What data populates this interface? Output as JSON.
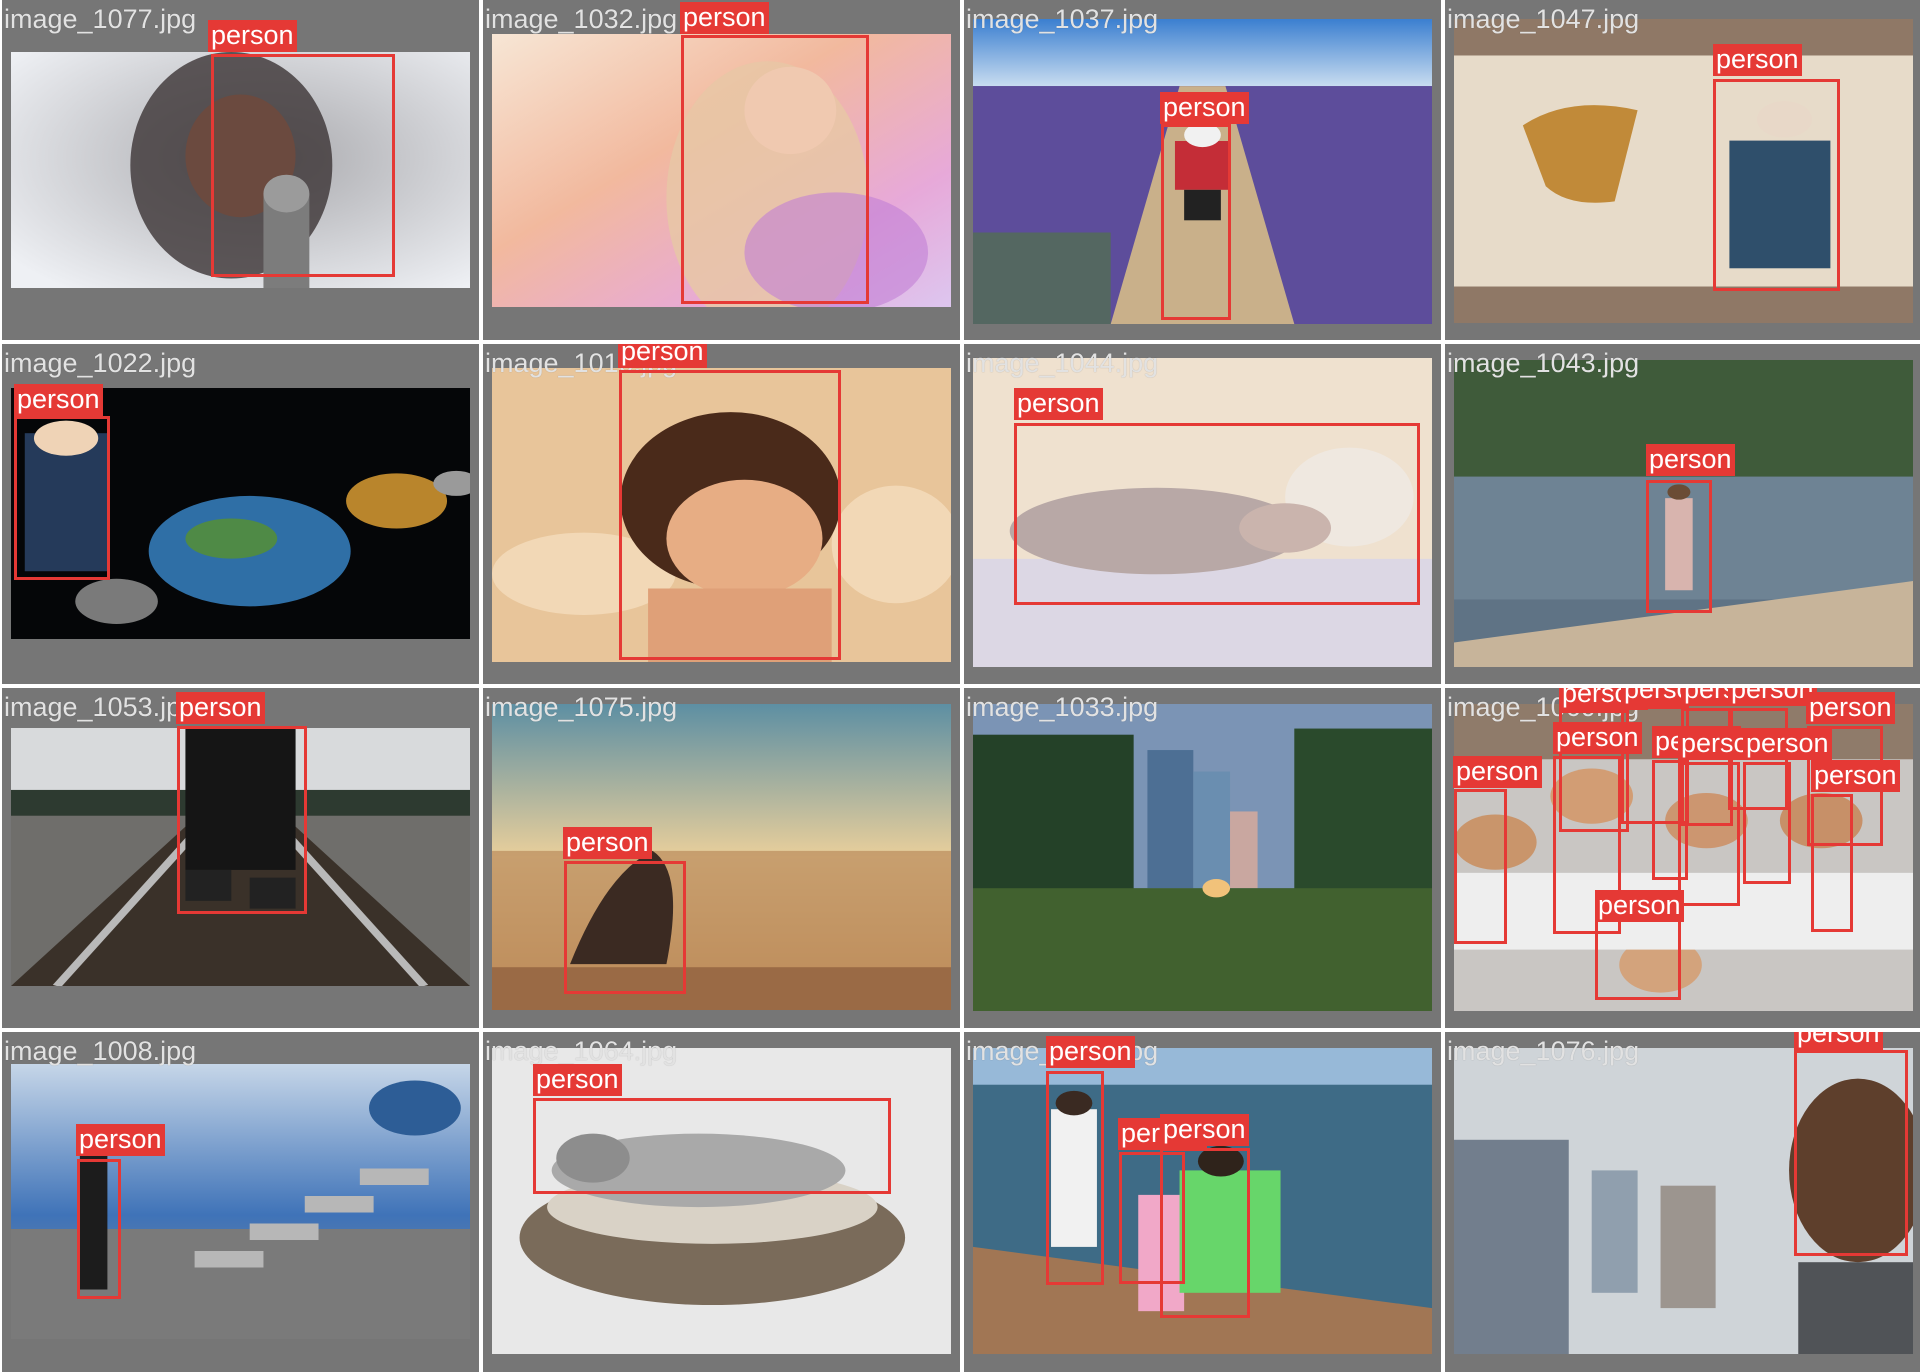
{
  "colors": {
    "tile_bg": "#767676",
    "box": "#e53935",
    "label_text": "#ffffff",
    "filename_text": "#e2e2e2"
  },
  "tiles": [
    {
      "filename": "image_1077.jpg",
      "scene": "girl-singing-with-microphone",
      "boxes": [
        {
          "label": "person"
        }
      ]
    },
    {
      "filename": "image_1032.jpg",
      "scene": "woman-portrait-pastel",
      "boxes": [
        {
          "label": "person"
        }
      ]
    },
    {
      "filename": "image_1037.jpg",
      "scene": "child-in-lavender-field",
      "boxes": [
        {
          "label": "person"
        }
      ]
    },
    {
      "filename": "image_1047.jpg",
      "scene": "saxophone-player",
      "boxes": [
        {
          "label": "person"
        }
      ]
    },
    {
      "filename": "image_1022.jpg",
      "scene": "boy-with-camera-and-planets",
      "boxes": [
        {
          "label": "person"
        }
      ]
    },
    {
      "filename": "image_1010.jpg",
      "scene": "child-on-beach-sand",
      "boxes": [
        {
          "label": "person"
        }
      ]
    },
    {
      "filename": "image_1044.jpg",
      "scene": "sleeping-newborn-with-knit-hat",
      "boxes": [
        {
          "label": "person"
        }
      ]
    },
    {
      "filename": "image_1043.jpg",
      "scene": "girl-walking-on-lakeshore",
      "boxes": [
        {
          "label": "person"
        }
      ]
    },
    {
      "filename": "image_1053.jpg",
      "scene": "legs-on-railroad-tracks",
      "boxes": [
        {
          "label": "person"
        }
      ]
    },
    {
      "filename": "image_1075.jpg",
      "scene": "yoga-pose-by-sea-at-sunset",
      "boxes": [
        {
          "label": "person"
        }
      ]
    },
    {
      "filename": "image_1033.jpg",
      "scene": "city-park-skyline",
      "boxes": []
    },
    {
      "filename": "image_1060.jpg",
      "scene": "group-of-smiling-children",
      "boxes": [
        {
          "label": "person"
        },
        {
          "label": "person"
        },
        {
          "label": "person"
        },
        {
          "label": "person"
        },
        {
          "label": "person"
        },
        {
          "label": "person"
        },
        {
          "label": "person"
        },
        {
          "label": "person"
        },
        {
          "label": "person"
        },
        {
          "label": "person"
        },
        {
          "label": "person"
        },
        {
          "label": "person"
        }
      ]
    },
    {
      "filename": "image_1008.jpg",
      "scene": "man-and-stairs-to-earth",
      "boxes": [
        {
          "label": "person"
        }
      ]
    },
    {
      "filename": "image_1064.jpg",
      "scene": "newborn-in-wicker-basket",
      "boxes": [
        {
          "label": "person"
        }
      ]
    },
    {
      "filename": "image_1062.jpg",
      "scene": "children-on-wooden-dock",
      "boxes": [
        {
          "label": "person"
        },
        {
          "label": "person"
        },
        {
          "label": "person"
        }
      ]
    },
    {
      "filename": "image_1076.jpg",
      "scene": "airplane-cabin-passenger",
      "boxes": [
        {
          "label": "person"
        }
      ]
    }
  ]
}
